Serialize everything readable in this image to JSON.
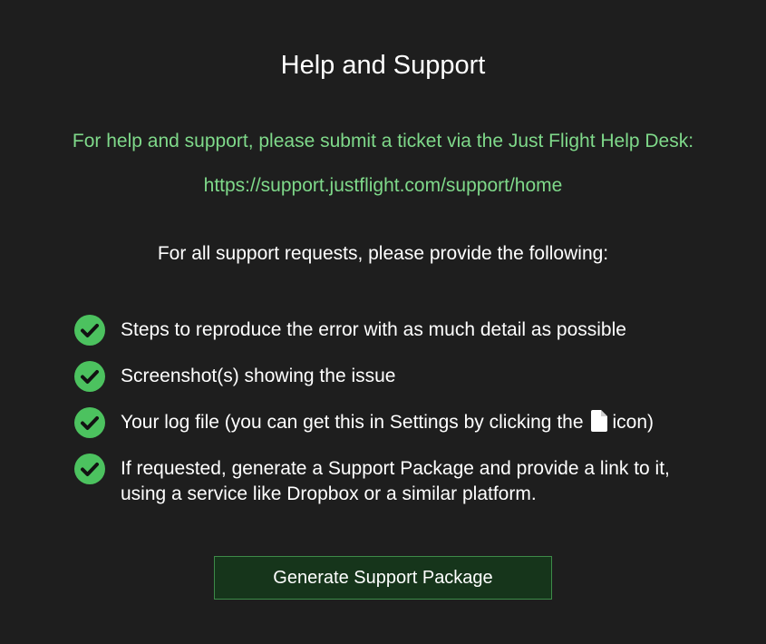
{
  "title": "Help and Support",
  "intro": "For help and support, please submit a ticket via the Just Flight Help Desk:",
  "support_url": "https://support.justflight.com/support/home",
  "requests_heading": "For all support requests, please provide the following:",
  "requirements": [
    {
      "icon": "check-circle-icon",
      "text": "Steps to reproduce the error with as much detail as possible"
    },
    {
      "icon": "check-circle-icon",
      "text": "Screenshot(s) showing the issue"
    },
    {
      "icon": "check-circle-icon",
      "text_before": "Your log file (you can get this in Settings by clicking the",
      "inline_icon": "file-icon",
      "text_after": "icon)"
    },
    {
      "icon": "check-circle-icon",
      "text": "If requested, generate a Support Package and provide a link to it, using a service like Dropbox or a similar platform."
    }
  ],
  "button_label": "Generate Support Package",
  "colors": {
    "background": "#1e1e1e",
    "accent_green": "#7fd98a",
    "check_green": "#4cc25f",
    "button_bg": "#16351b",
    "button_border": "#3d8a48"
  }
}
